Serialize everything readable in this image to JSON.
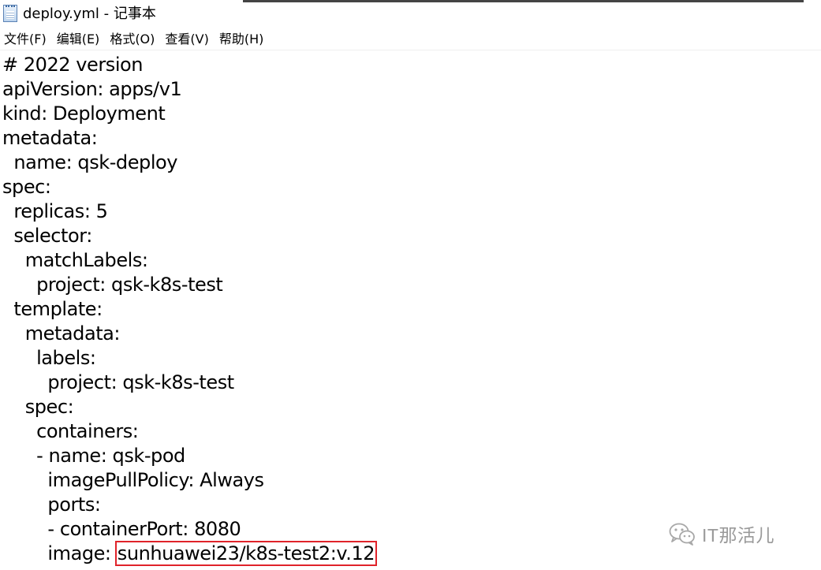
{
  "window": {
    "title": "deploy.yml - 记事本",
    "icon": "notepad-icon"
  },
  "menu": [
    {
      "label": "文件(F)"
    },
    {
      "label": "编辑(E)"
    },
    {
      "label": "格式(O)"
    },
    {
      "label": "查看(V)"
    },
    {
      "label": "帮助(H)"
    }
  ],
  "editor": {
    "lines": [
      "# 2022 version",
      "apiVersion: apps/v1",
      "kind: Deployment",
      "metadata:",
      "  name: qsk-deploy",
      "spec:",
      "  replicas: 5",
      "  selector:",
      "    matchLabels:",
      "      project: qsk-k8s-test",
      "  template:",
      "    metadata:",
      "      labels:",
      "        project: qsk-k8s-test",
      "    spec:",
      "      containers:",
      "      - name: qsk-pod",
      "        imagePullPolicy: Always",
      "        ports:",
      "        - containerPort: 8080"
    ],
    "last_line_prefix": "        image: ",
    "highlighted_value": "sunhuawei23/k8s-test2:v.12",
    "highlight_color": "#e0232a"
  },
  "watermark": {
    "text": "IT那活儿",
    "icon": "wechat-logo"
  }
}
